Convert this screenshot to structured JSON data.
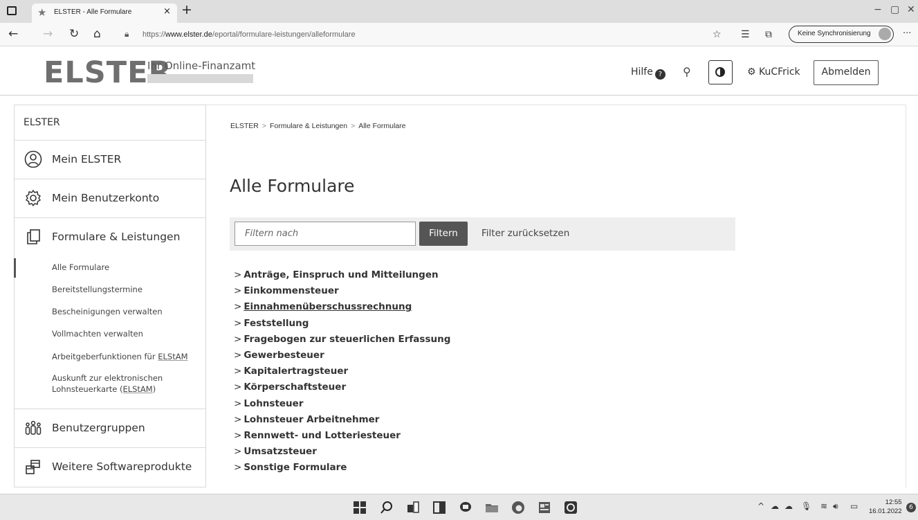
{
  "browser": {
    "tab_title": "ELSTER - Alle Formulare",
    "new_tab": "+",
    "tab_close": "×",
    "url_prefix": "https://",
    "url_host": "www.elster.de",
    "url_path": "/eportal/formulare-leistungen/alleformulare",
    "sync_label": "Keine Synchronisierung",
    "more": "···"
  },
  "header": {
    "logo": "ELSTER",
    "subtitle": "Ihr Online-Finanzamt",
    "help": "Hilfe",
    "user": "KuCFrick",
    "logout": "Abmelden"
  },
  "sidebar": {
    "title": "ELSTER",
    "items": [
      {
        "label": "Mein ELSTER",
        "icon": "user-circle-icon"
      },
      {
        "label": "Mein Benutzerkonto",
        "icon": "gear-icon"
      },
      {
        "label": "Formulare & Leistungen",
        "icon": "documents-icon"
      },
      {
        "label": "Benutzergruppen",
        "icon": "user-group-icon"
      },
      {
        "label": "Weitere Softwareprodukte",
        "icon": "windows-stack-icon"
      }
    ],
    "subitems": [
      "Alle Formulare",
      "Bereitstellungstermine",
      "Bescheinigungen verwalten",
      "Vollmachten verwalten"
    ],
    "sub_arbeitgeber": "Arbeitgeberfunktionen für ",
    "sub_arbeitgeber_link": "ELStAM",
    "sub_auskunft_1": "Auskunft zur elektronischen",
    "sub_auskunft_2a": "Lohnsteuerkarte (",
    "sub_auskunft_2b": "ELStAM",
    "sub_auskunft_2c": ")"
  },
  "main": {
    "breadcrumb": [
      "ELSTER",
      "Formulare & Leistungen",
      "Alle Formulare"
    ],
    "breadcrumb_sep": ">",
    "title": "Alle Formulare",
    "filter_placeholder": "Filtern nach",
    "filter_button": "Filtern",
    "filter_reset": "Filter zurücksetzen",
    "categories": [
      "Anträge, Einspruch und Mitteilungen",
      "Einkommensteuer",
      "Einnahmenüberschussrechnung",
      "Feststellung",
      "Fragebogen zur steuerlichen Erfassung",
      "Gewerbesteuer",
      "Kapitalertragsteuer",
      "Körperschaftsteuer",
      "Lohnsteuer",
      "Lohnsteuer Arbeitnehmer",
      "Rennwett- und Lotteriesteuer",
      "Umsatzsteuer",
      "Sonstige Formulare"
    ]
  },
  "taskbar": {
    "time": "12:55",
    "date": "16.01.2022",
    "notifications": "6"
  }
}
